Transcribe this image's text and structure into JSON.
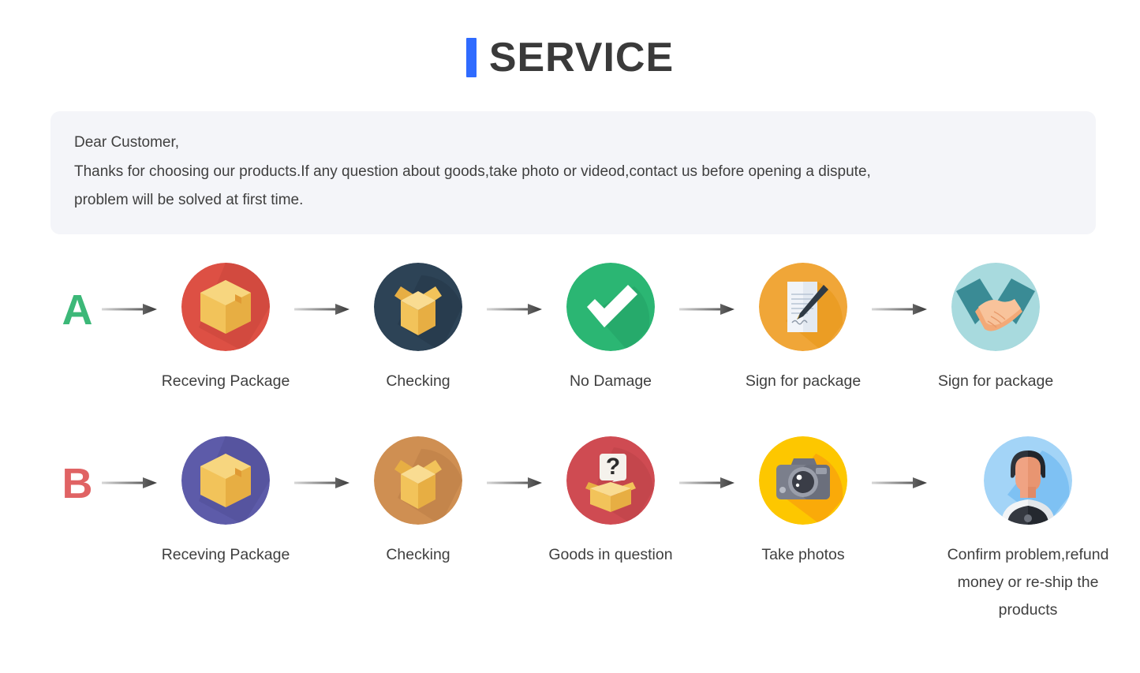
{
  "header": {
    "accent_color": "#2f6bff",
    "title": "SERVICE"
  },
  "notice": {
    "line1": "Dear Customer,",
    "line2": "Thanks for choosing our products.If any question about goods,take photo or videod,contact us before opening a dispute,",
    "line3": "problem will be solved at first time."
  },
  "flows": [
    {
      "letter": "A",
      "letter_color": "#3cb878",
      "steps": [
        {
          "icon": "closed-box-icon",
          "circle_color": "#dd5044",
          "caption": "Receving Package"
        },
        {
          "icon": "open-box-icon",
          "circle_color": "#2d4356",
          "caption": "Checking"
        },
        {
          "icon": "check-mark-icon",
          "circle_color": "#2bb673",
          "caption": "No Damage"
        },
        {
          "icon": "sign-document-icon",
          "circle_color": "#f0a638",
          "caption": "Sign for package"
        },
        {
          "icon": "handshake-icon",
          "circle_color": "#a8dade",
          "caption": "Sign for package"
        }
      ]
    },
    {
      "letter": "B",
      "letter_color": "#e06364",
      "steps": [
        {
          "icon": "closed-box-icon",
          "circle_color": "#5d5ba9",
          "caption": "Receving Package"
        },
        {
          "icon": "open-box-icon",
          "circle_color": "#cf8f52",
          "caption": "Checking"
        },
        {
          "icon": "question-box-icon",
          "circle_color": "#cf4b52",
          "caption": "Goods in question"
        },
        {
          "icon": "camera-icon",
          "circle_color": "#fdc700",
          "caption": "Take photos"
        },
        {
          "icon": "support-person-icon",
          "circle_color": "#a3d4f7",
          "caption": "Confirm problem,refund money or re-ship the products"
        }
      ]
    }
  ],
  "arrow": {
    "name": "arrow-right-icon"
  }
}
